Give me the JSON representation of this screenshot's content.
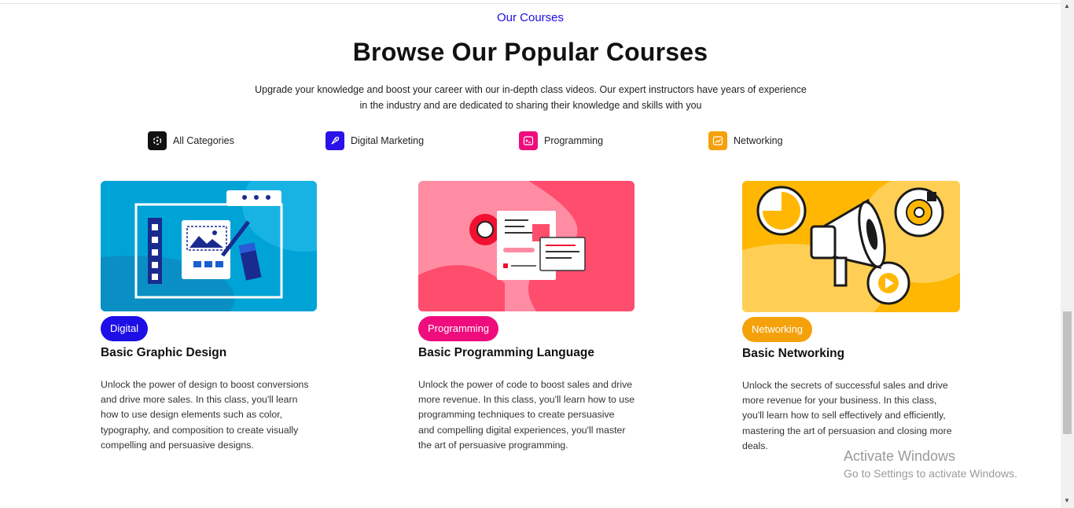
{
  "header": {
    "eyebrow": "Our Courses",
    "title": "Browse Our Popular Courses",
    "intro_line1": "Upgrade your knowledge and boost your career with our in-depth class videos. Our expert instructors have years of experience",
    "intro_line2": "in the industry and are dedicated to sharing their knowledge and skills with you"
  },
  "categories": [
    {
      "label": "All Categories",
      "icon": "grid-icon",
      "color": "#111111"
    },
    {
      "label": "Digital Marketing",
      "icon": "rocket-icon",
      "color": "#2a12e8"
    },
    {
      "label": "Programming",
      "icon": "terminal-icon",
      "color": "#ef0d7d"
    },
    {
      "label": "Networking",
      "icon": "chart-icon",
      "color": "#f5a10b"
    }
  ],
  "courses": [
    {
      "badge": "Digital",
      "badge_color": "#1e0fe6",
      "title": "Basic Graphic Design",
      "desc": [
        "Unlock the power of design to boost conversions",
        "and drive more sales. In this class, you'll learn",
        "how to use design elements such as color,",
        "typography, and composition to create visually",
        "compelling and persuasive designs."
      ],
      "image": "design-illustration"
    },
    {
      "badge": "Programming",
      "badge_color": "#ef0d7d",
      "title": "Basic Programming Language",
      "desc": [
        "Unlock the power of code to boost sales and drive",
        "more revenue. In this class, you'll learn how to use",
        "programming techniques to create persuasive",
        "and compelling digital experiences, you'll master",
        "the art of persuasive programming."
      ],
      "image": "programming-illustration"
    },
    {
      "badge": "Networking",
      "badge_color": "#f5a10b",
      "title": "Basic Networking",
      "desc": [
        "Unlock the secrets of successful sales and drive",
        "more revenue for your business. In this class,",
        "you'll learn how to sell effectively and efficiently,",
        "mastering the art of persuasion and closing more",
        "deals."
      ],
      "image": "marketing-illustration"
    }
  ],
  "watermark": {
    "line1": "Activate Windows",
    "line2": "Go to Settings to activate Windows."
  }
}
